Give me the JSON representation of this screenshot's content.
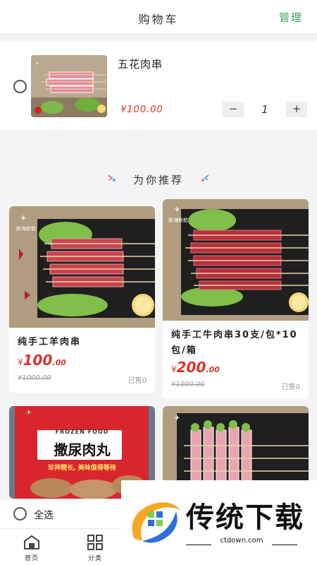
{
  "header": {
    "title": "购物车",
    "manage": "管理"
  },
  "cart": {
    "item": {
      "name": "五花肉串",
      "price": "¥100.00",
      "quantity": "1",
      "minus": "−",
      "plus": "+"
    }
  },
  "recommend": {
    "title": "为你推荐",
    "products": [
      {
        "name": "纯手工羊肉串",
        "currency": "¥",
        "price_int": "100",
        "price_dec": ".00",
        "old_price": "¥1000.00",
        "sold": "已售0"
      },
      {
        "name_line1": "纯手工牛肉串30支/包*10",
        "name_line2": "包/箱",
        "currency": "¥",
        "price_int": "200",
        "price_dec": ".00",
        "old_price": "¥1000.00",
        "sold": "已售0"
      },
      {
        "bag_label": "FROZEN FOOD",
        "bag_title": "撒尿肉丸",
        "bag_slogan": "珍拌精长, 美味值得等待"
      }
    ]
  },
  "bottom": {
    "select_all": "全选"
  },
  "tabs": [
    {
      "label": "首页"
    },
    {
      "label": "分类"
    }
  ],
  "watermark": {
    "text": "传统下载",
    "url": "ctdown.com"
  },
  "colors": {
    "accent": "#3aa35b",
    "price": "#d9362b"
  }
}
